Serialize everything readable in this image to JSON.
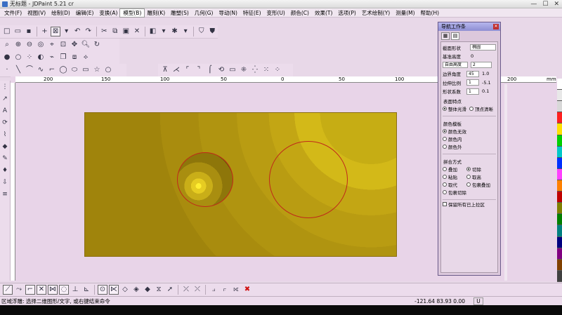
{
  "window": {
    "title": "无标题 - JDPaint 5.21 cr",
    "controls": [
      "—",
      "☐",
      "✕"
    ]
  },
  "menu": [
    "文件(F)",
    "视图(V)",
    "绘制(D)",
    "编辑(E)",
    "变换(A)",
    "模型(B)",
    "雕刻(K)",
    "雕塑(S)",
    "几何(G)",
    "导动(N)",
    "特征(E)",
    "变形(U)",
    "颜色(C)",
    "效果(T)",
    "选项(P)",
    "艺术绘制(Y)",
    "测量(M)",
    "帮助(H)"
  ],
  "ruler": {
    "top_labels": [
      "200",
      "150",
      "100",
      "50",
      "0",
      "50",
      "100",
      "150",
      "200",
      "mm"
    ]
  },
  "nav_panel": {
    "title": "导航工作条",
    "fields": [
      {
        "label": "截面形状",
        "value": "椭圆"
      },
      {
        "label": "基准高度",
        "value": "0"
      },
      {
        "label": "自由高度",
        "value": "2"
      },
      {
        "label": "边界角度",
        "value": "45",
        "extra": "1.0"
      },
      {
        "label": "拉伸比例",
        "value": "1",
        "extra": "-5.1"
      },
      {
        "label": "形状系数",
        "value": "1",
        "extra": "0.1"
      }
    ],
    "surface_label": "表面特点",
    "surface_opts": [
      "整体光滑",
      "顶点清晰"
    ],
    "color_group_label": "颜色模板",
    "color_opts": [
      "颜色无效",
      "颜色内",
      "颜色外"
    ],
    "merge_label": "拼合方式",
    "merge_opts": [
      "叠加",
      "切除",
      "粘贴",
      "取高",
      "取代",
      "包裹叠加",
      "包裹切除"
    ],
    "checkbox": "保留所有已上拉区"
  },
  "status": {
    "message": "区域浮雕: 选择二维图形/文字, 或右键结束命令",
    "coords": "-121.64  83.93  0.00",
    "unit": "U"
  },
  "palette": [
    "#ffffff",
    "#e8e8e8",
    "#d8d8d8",
    "#ff2020",
    "#ffe000",
    "#00d000",
    "#00c8c8",
    "#0030ff",
    "#ff40ff",
    "#ff8000",
    "#c00000",
    "#808000",
    "#008000",
    "#008080",
    "#000080",
    "#800080",
    "#804000",
    "#404040"
  ]
}
